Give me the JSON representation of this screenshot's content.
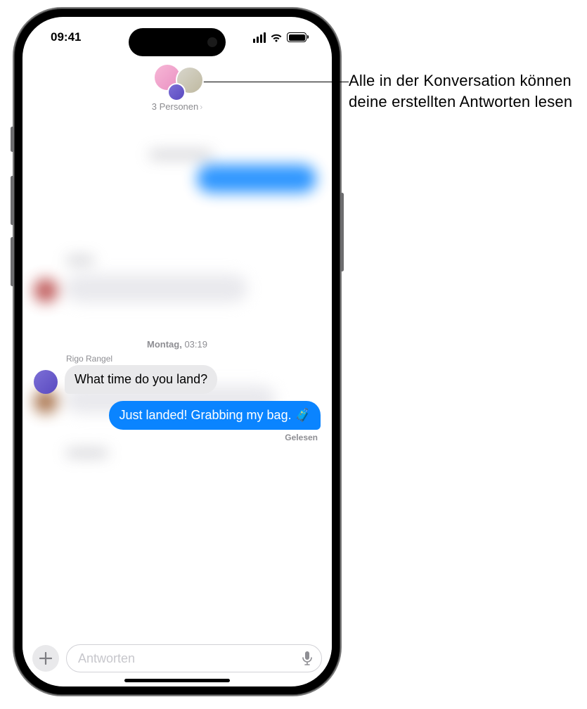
{
  "status": {
    "time": "09:41"
  },
  "header": {
    "group_label": "3 Personen"
  },
  "timestamp": {
    "day": "Montag,",
    "time": "03:19"
  },
  "messages": {
    "incoming_sender": "Rigo Rangel",
    "incoming_text": "What time do you land?",
    "outgoing_text": "Just landed! Grabbing my bag. 🧳",
    "read_receipt": "Gelesen"
  },
  "input": {
    "placeholder": "Antworten"
  },
  "callout": {
    "text": "Alle in der Konversation können deine erstellten Antworten lesen"
  }
}
